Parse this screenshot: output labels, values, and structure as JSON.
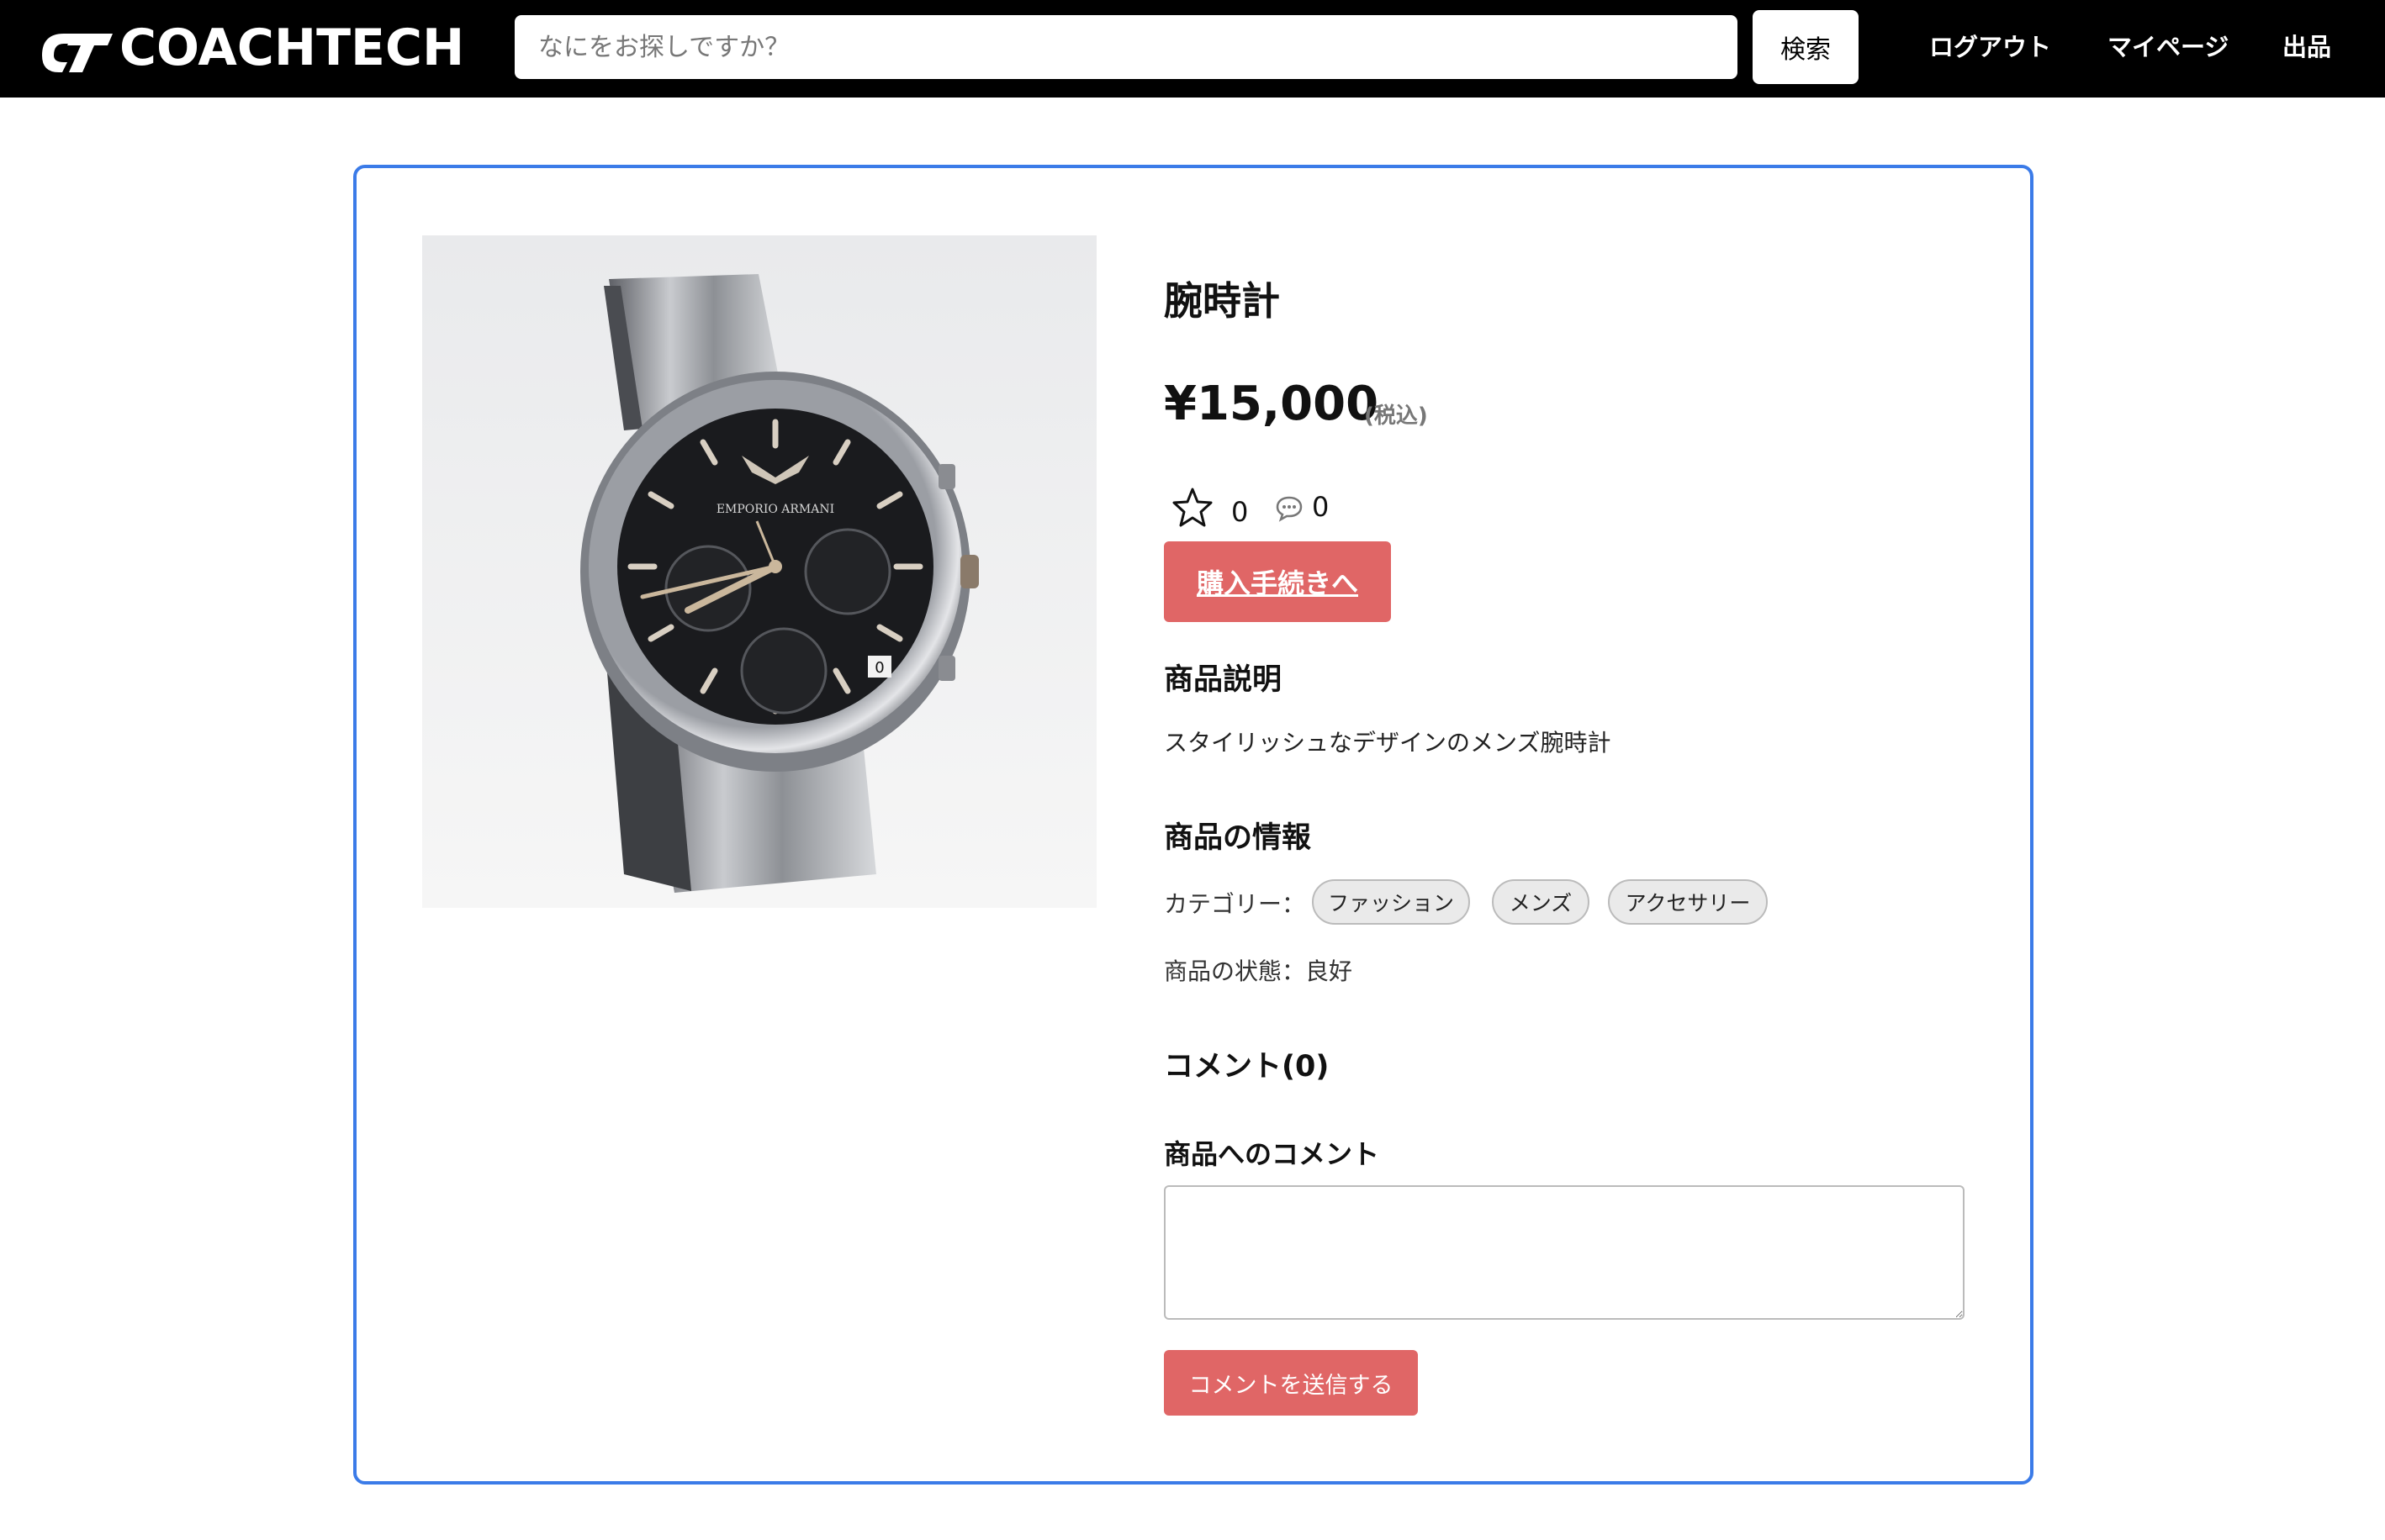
{
  "header": {
    "logo_text": "COACHTECH",
    "search_placeholder": "なにをお探しですか？",
    "search_button": "検索",
    "nav": {
      "logout": "ログアウト",
      "mypage": "マイページ",
      "sell": "出品"
    }
  },
  "product": {
    "image_icon": "wristwatch-photo",
    "title": "腕時計",
    "price": "¥15,000",
    "tax_note": "(税込)",
    "like_count": "0",
    "comment_count": "0",
    "buy_button": "購入手続きへ",
    "description_heading": "商品説明",
    "description": "スタイリッシュなデザインのメンズ腕時計",
    "info_heading": "商品の情報",
    "category_label": "カテゴリー：",
    "categories": [
      "ファッション",
      "メンズ",
      "アクセサリー"
    ],
    "condition": "商品の状態：良好",
    "comments_heading": "コメント(0)",
    "comment_form_label": "商品へのコメント",
    "comment_submit": "コメントを送信する"
  },
  "colors": {
    "header_bg": "#000000",
    "card_border": "#3b7be8",
    "accent_button": "#e06666"
  }
}
